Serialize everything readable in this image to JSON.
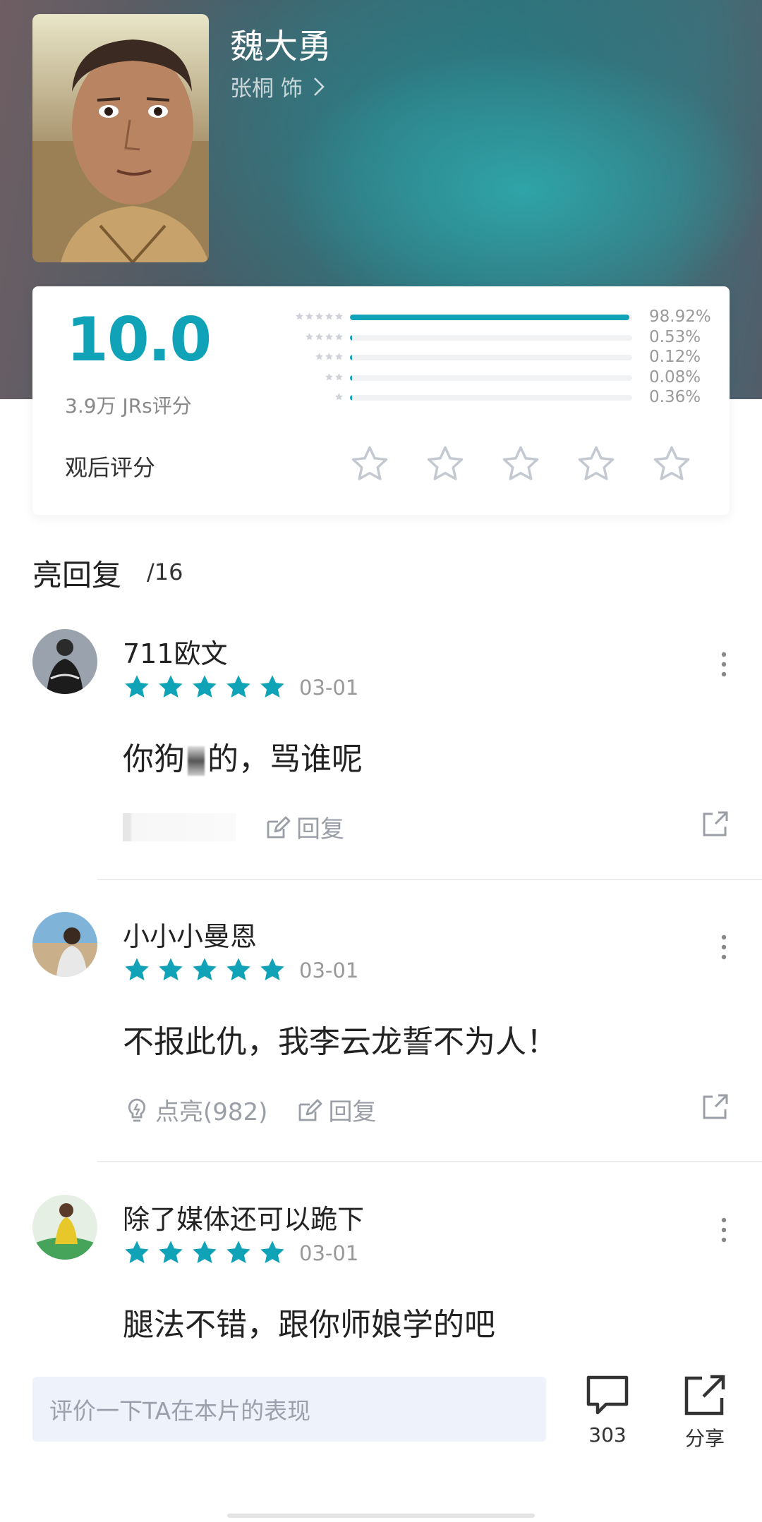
{
  "header": {
    "character_name": "魏大勇",
    "actor_link": "张桐 饰"
  },
  "rating": {
    "score": "10.0",
    "count_label": "3.9万 JRs评分",
    "distribution": [
      {
        "stars": 5,
        "percent_label": "98.92%",
        "fraction": 0.9892
      },
      {
        "stars": 4,
        "percent_label": "0.53%",
        "fraction": 0.0053
      },
      {
        "stars": 3,
        "percent_label": "0.12%",
        "fraction": 0.0012
      },
      {
        "stars": 2,
        "percent_label": "0.08%",
        "fraction": 0.0008
      },
      {
        "stars": 1,
        "percent_label": "0.36%",
        "fraction": 0.0036
      }
    ],
    "after_watch_label": "观后评分",
    "accent_color": "#10a3b8"
  },
  "hot_replies": {
    "title": "亮回复",
    "count": "/16",
    "comments": [
      {
        "username": "711欧文",
        "date": "03-01",
        "text_before": "你狗",
        "text_after": "的，骂谁呢",
        "like_label": "",
        "reply_label": "回复",
        "stars": 5
      },
      {
        "username": "小小小曼恩",
        "date": "03-01",
        "text": "不报此仇，我李云龙誓不为人！",
        "like_label": "点亮(982)",
        "reply_label": "回复",
        "stars": 5
      },
      {
        "username": "除了媒体还可以跪下",
        "date": "03-01",
        "text": "腿法不错，跟你师娘学的吧",
        "stars": 5
      }
    ]
  },
  "bottom_bar": {
    "input_placeholder": "评价一下TA在本片的表现",
    "comment_count": "303",
    "share_label": "分享"
  }
}
